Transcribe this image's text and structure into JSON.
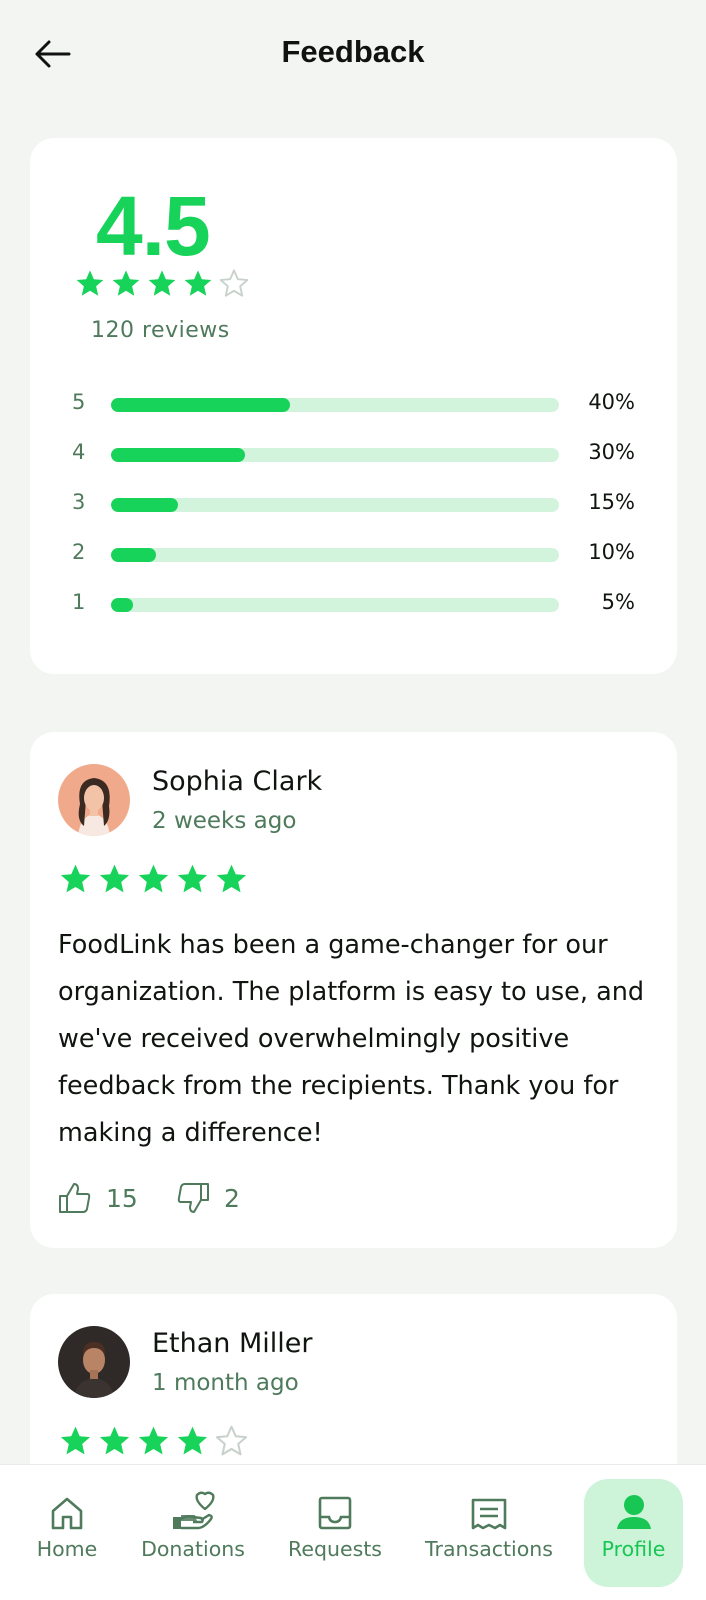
{
  "header": {
    "title": "Feedback"
  },
  "summary": {
    "rating": "4.5",
    "stars": 4.5,
    "review_count": "120 reviews",
    "distribution": [
      {
        "label": "5",
        "percent": 40,
        "percent_text": "40%"
      },
      {
        "label": "4",
        "percent": 30,
        "percent_text": "30%"
      },
      {
        "label": "3",
        "percent": 15,
        "percent_text": "15%"
      },
      {
        "label": "2",
        "percent": 10,
        "percent_text": "10%"
      },
      {
        "label": "1",
        "percent": 5,
        "percent_text": "5%"
      }
    ]
  },
  "reviews": [
    {
      "name": "Sophia Clark",
      "time": "2 weeks ago",
      "stars": 5,
      "text": "FoodLink has been a game-changer for our organization. The platform is easy to use, and we've received overwhelmingly positive feedback from the recipients. Thank you for making a difference!",
      "likes": "15",
      "dislikes": "2"
    },
    {
      "name": "Ethan Miller",
      "time": "1 month ago",
      "stars": 4
    }
  ],
  "nav": {
    "items": [
      {
        "label": "Home",
        "icon": "home-icon"
      },
      {
        "label": "Donations",
        "icon": "donations-icon"
      },
      {
        "label": "Requests",
        "icon": "inbox-icon"
      },
      {
        "label": "Transactions",
        "icon": "receipt-icon"
      },
      {
        "label": "Profile",
        "icon": "user-icon",
        "active": true
      }
    ]
  },
  "colors": {
    "accent": "#17d35a",
    "muted_text": "#4f7a5c",
    "track": "#d2f4dc",
    "active_nav_bg": "#cdf3d9",
    "background": "#f3f5f2"
  }
}
